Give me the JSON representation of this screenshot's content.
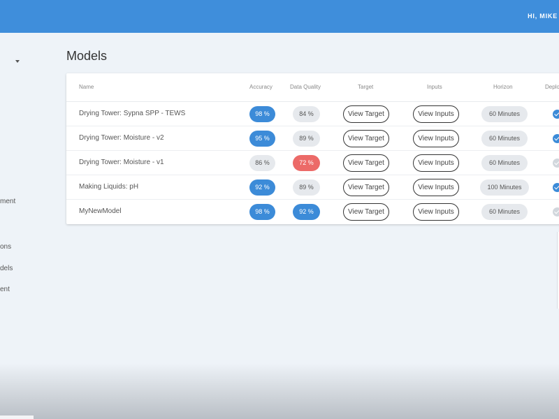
{
  "header": {
    "greeting": "HI, MIKE"
  },
  "sidebar": {
    "items": [
      {
        "label": "ment"
      },
      {
        "label": "ons"
      },
      {
        "label": "dels"
      },
      {
        "label": "ent"
      }
    ]
  },
  "page": {
    "title": "Models"
  },
  "table": {
    "columns": [
      "Name",
      "Accuracy",
      "Data Quality",
      "Target",
      "Inputs",
      "Horizon",
      "Deplo"
    ],
    "rows": [
      {
        "name": "Drying Tower: Sypna SPP - TEWS",
        "accuracy": "98 %",
        "data_quality": "84 %",
        "target": "View Target",
        "inputs": "View Inputs",
        "horizon": "60 Minutes",
        "deployed": true
      },
      {
        "name": "Drying Tower: Moisture - v2",
        "accuracy": "95 %",
        "data_quality": "89 %",
        "target": "View Target",
        "inputs": "View Inputs",
        "horizon": "60 Minutes",
        "deployed": true
      },
      {
        "name": "Drying Tower: Moisture - v1",
        "accuracy": "86 %",
        "data_quality": "72 %",
        "target": "View Target",
        "inputs": "View Inputs",
        "horizon": "60 Minutes",
        "deployed": false
      },
      {
        "name": "Making Liquids: pH",
        "accuracy": "92 %",
        "data_quality": "89 %",
        "target": "View Target",
        "inputs": "View Inputs",
        "horizon": "100 Minutes",
        "deployed": true
      },
      {
        "name": "MyNewModel",
        "accuracy": "98 %",
        "data_quality": "92 %",
        "target": "View Target",
        "inputs": "View Inputs",
        "horizon": "60 Minutes",
        "deployed": false
      }
    ],
    "pill_styles": {
      "accuracy": [
        "blue",
        "blue",
        "gray",
        "blue",
        "blue"
      ],
      "data_quality": [
        "gray",
        "gray",
        "red",
        "gray",
        "blue"
      ]
    }
  },
  "colors": {
    "topbar": "#3f8edb",
    "accent_blue": "#3c8bd8",
    "alert_red": "#ec6a68",
    "neutral_pill": "#e6e9ed"
  }
}
